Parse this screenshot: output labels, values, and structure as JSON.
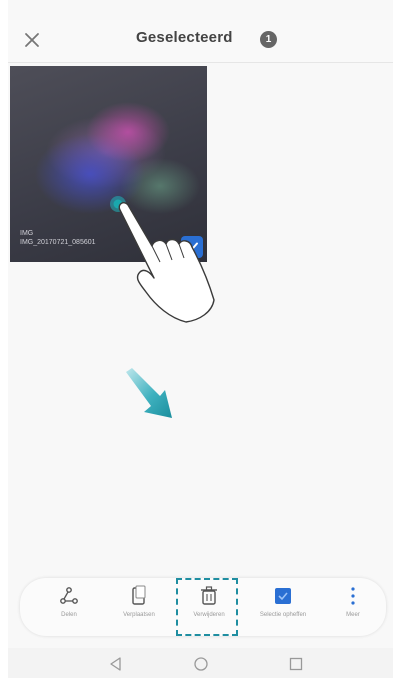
{
  "header": {
    "title": "Geselecteerd",
    "count": "1"
  },
  "thumbnail": {
    "caption_line1": "IMG",
    "caption_line2": "IMG_20170721_085601",
    "selected": true
  },
  "toolbar": {
    "items": [
      {
        "label": "Delen",
        "icon": "share-icon"
      },
      {
        "label": "Verplaatsen",
        "icon": "move-icon"
      },
      {
        "label": "Verwijderen",
        "icon": "trash-icon"
      },
      {
        "label": "Selectie opheffen",
        "icon": "deselect-icon"
      },
      {
        "label": "Meer",
        "icon": "more-icon"
      }
    ],
    "highlighted": "Verwijderen"
  },
  "colors": {
    "accent": "#1f8ea1",
    "checkbox": "#2a6fd3",
    "badge": "#666666"
  },
  "navbar": {
    "icons": [
      "back-icon",
      "home-icon",
      "recents-icon"
    ]
  }
}
